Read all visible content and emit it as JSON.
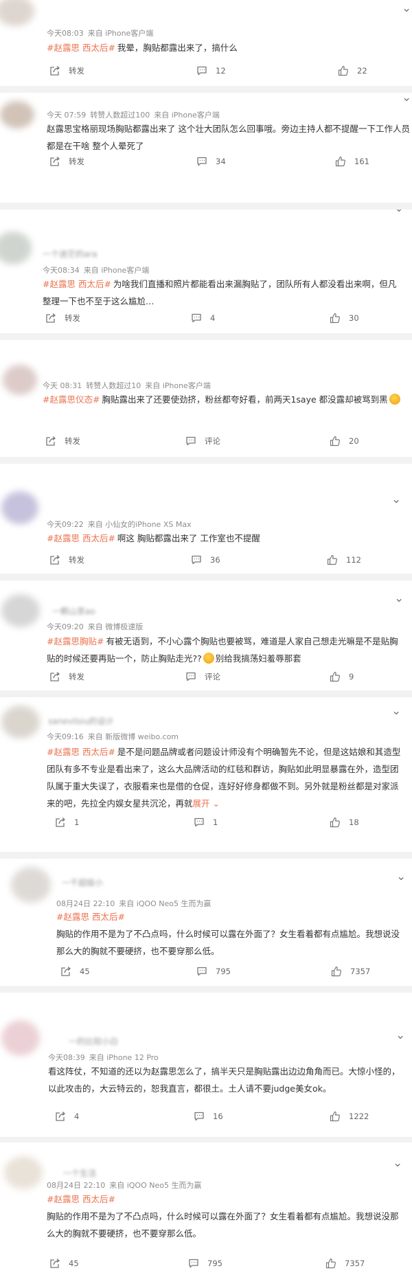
{
  "colors": {
    "tag": "#eb7350",
    "meta": "#8c8c8c",
    "text": "#333333",
    "background": "#f2f2f2"
  },
  "icons": {
    "repost": "share-arrow-box-icon",
    "comment": "speech-bubble-icon",
    "like": "thumbs-up-icon",
    "more": "chevron-down-icon"
  },
  "posts": [
    {
      "name": "",
      "meta": [
        "今天08:03",
        "来自 iPhone客户端"
      ],
      "tags": [
        "#赵露思 西太后#"
      ],
      "text": "我晕，胸贴都露出来了，搞什么",
      "repost": "转发",
      "comments": "12",
      "likes": "22"
    },
    {
      "name": "",
      "meta": [
        "今天 07:59",
        "转赞人数超过100",
        "来自 iPhone客户端"
      ],
      "tags": [],
      "text": "赵露思宝格丽现场胸贴都露出来了 这个壮大团队怎么回事哦。旁边主持人都不提醒一下工作人员都是在干啥 整个人晕死了",
      "repost": "转发",
      "comments": "34",
      "likes": "161"
    },
    {
      "name": "一个迷茫的ara",
      "meta": [
        "今天08:34",
        "来自 iPhone客户端"
      ],
      "tags": [
        "#赵露思 西太后#"
      ],
      "text": "为啥我们直播和照片都能看出来漏胸贴了，团队所有人都没看出来啊，但凡整理一下也不至于这么尴尬…",
      "repost": "转发",
      "comments": "4",
      "likes": "30"
    },
    {
      "name": "",
      "meta": [
        "今天 08:31",
        "转赞人数超过10",
        "来自 iPhone客户端"
      ],
      "tags": [
        "#赵露思仪态#"
      ],
      "text": "胸贴露出来了还要使劲挤，粉丝都夸好看，前两天1saye 都没露却被骂到黑",
      "repost": "转发",
      "comments": "评论",
      "likes": "20"
    },
    {
      "name": "",
      "meta": [
        "今天09:22",
        "来自 小仙女的iPhone XS Max"
      ],
      "tags": [
        "#赵露思 西太后#"
      ],
      "text": "啊这 胸贴都露出来了 工作室也不提醒",
      "repost": "转发",
      "comments": "36",
      "likes": "112"
    },
    {
      "name": "一颗山茶ao",
      "meta": [
        "今天09:20",
        "来自 微博极速版"
      ],
      "tags": [
        "#赵露思胸贴#"
      ],
      "text": "有被无语到，不小心露个胸贴也要被骂，难道是人家自己想走光嘛是不是贴胸贴的时候还要再贴一个，防止胸贴走光??",
      "text_after": "别给我搞荡妇羞辱那套",
      "repost": "转发",
      "comments": "评论",
      "likes": "9"
    },
    {
      "name": "sanevilsiu的设计",
      "meta": [
        "今天09:16",
        "来自 新版微博 weibo.com"
      ],
      "tags": [
        "#赵露思 西太后#"
      ],
      "text": "是不是问题品牌或者问题设计师没有个明确暂先不论，但是这姑娘和其造型团队有多不专业是看出来了，这么大品牌活动的红毯和群访，胸贴如此明显暴露在外，造型团队属于重大失误了，衣服看来也是借的仓促，连好好修身都做不到。另外就是粉丝都是对家派来的吧，先拉全内娱女星共沉沦，再就",
      "expand": "展开",
      "repost": "1",
      "comments": "1",
      "likes": "18"
    },
    {
      "name": "一千超级小",
      "meta": [
        "08月24日 22:10",
        "来自 iQOO Neo5 生而为赢"
      ],
      "tags": [
        "#赵露思 西太后#"
      ],
      "text": "胸贴的作用不是为了不凸点吗，什么时候可以露在外面了？女生看着都有点尴尬。我想说没那么大的胸就不要硬挤，也不要穿那么低。",
      "repost": "45",
      "comments": "795",
      "likes": "7357"
    },
    {
      "name": "一的比较小白",
      "meta": [
        "今天08:39",
        "来自 iPhone 12 Pro"
      ],
      "tags": [],
      "text": "看这阵仗，不知道的还以为赵露思怎么了，搞半天只是胸贴露出边边角角而已。大惊小怪的，以此攻击的，大云特云的，恕我直言，都很土。土人请不要judge美女ok。",
      "repost": "4",
      "comments": "16",
      "likes": "1222"
    },
    {
      "name": "一个生活",
      "meta": [
        "08月24日 22:10",
        "来自 iQOO Neo5 生而为赢"
      ],
      "tags": [
        "#赵露思 西太后#"
      ],
      "text": "胸贴的作用不是为了不凸点吗，什么时候可以露在外面了？女生看着都有点尴尬。我想说没那么大的胸就不要硬挤，也不要穿那么低。",
      "repost": "45",
      "comments": "795",
      "likes": "7357"
    }
  ]
}
